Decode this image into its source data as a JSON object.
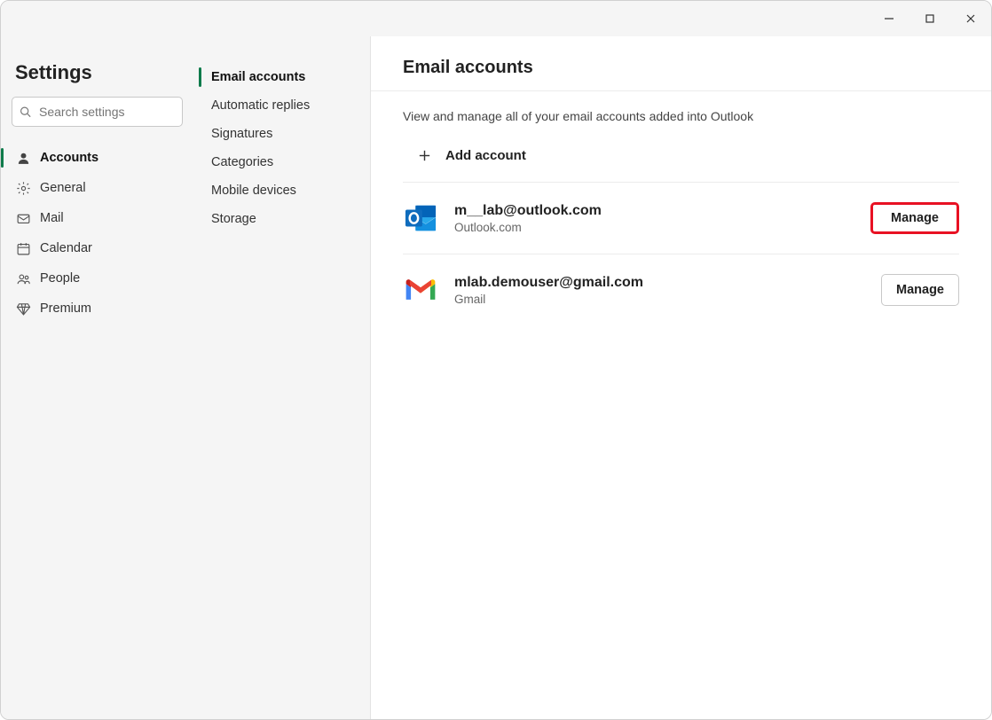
{
  "window": {
    "title": "Settings"
  },
  "search": {
    "placeholder": "Search settings"
  },
  "nav1": {
    "items": [
      {
        "label": "Accounts",
        "active": true
      },
      {
        "label": "General"
      },
      {
        "label": "Mail"
      },
      {
        "label": "Calendar"
      },
      {
        "label": "People"
      },
      {
        "label": "Premium"
      }
    ]
  },
  "nav2": {
    "items": [
      {
        "label": "Email accounts",
        "active": true
      },
      {
        "label": "Automatic replies"
      },
      {
        "label": "Signatures"
      },
      {
        "label": "Categories"
      },
      {
        "label": "Mobile devices"
      },
      {
        "label": "Storage"
      }
    ]
  },
  "main": {
    "heading": "Email accounts",
    "description": "View and manage all of your email accounts added into Outlook",
    "add_label": "Add account",
    "manage_label": "Manage",
    "accounts": [
      {
        "email": "m__lab@outlook.com",
        "provider": "Outlook.com",
        "highlighted": true
      },
      {
        "email": "mlab.demouser@gmail.com",
        "provider": "Gmail",
        "highlighted": false
      }
    ]
  }
}
